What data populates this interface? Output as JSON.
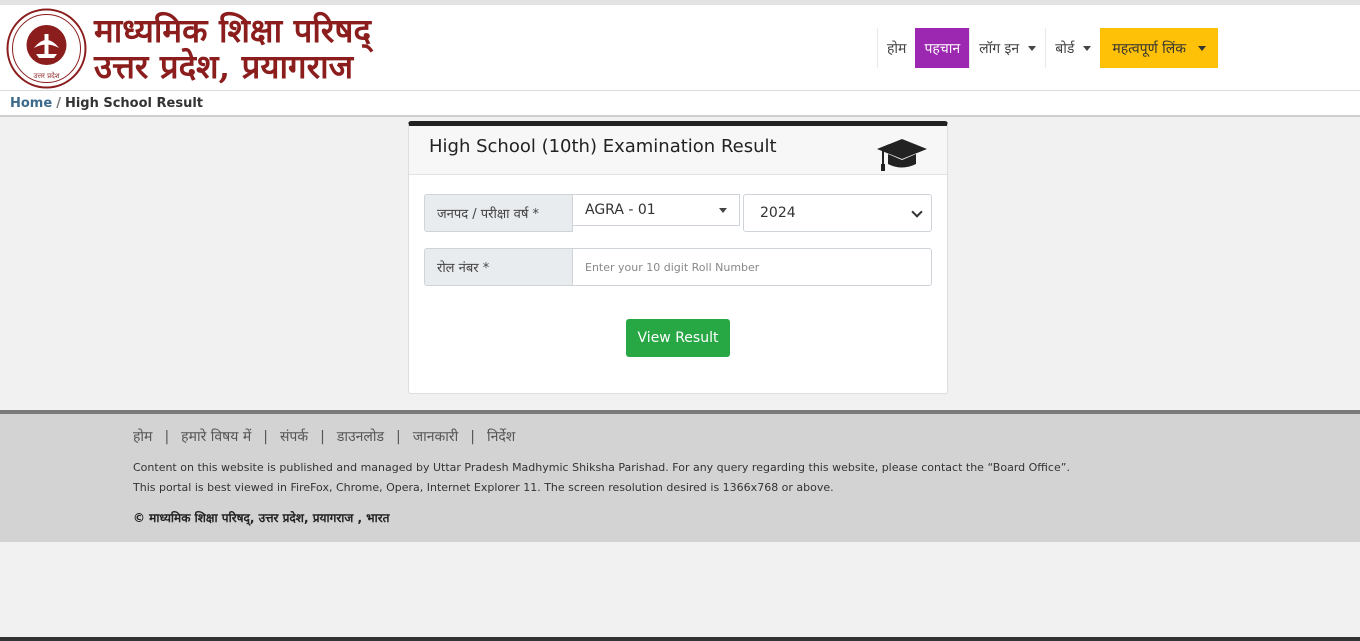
{
  "header": {
    "title_line1": "माध्यमिक शिक्षा परिषद्",
    "title_line2": "उत्तर प्रदेश, प्रयागराज",
    "logo_text": "उत्तर प्रदेश"
  },
  "nav": {
    "items": [
      {
        "label": "होम"
      },
      {
        "label": "पहचान"
      },
      {
        "label": "लॉग इन"
      },
      {
        "label": "बोर्ड"
      },
      {
        "label": "महत्वपूर्ण लिंक"
      }
    ]
  },
  "breadcrumb": {
    "home": "Home",
    "separator": "/",
    "current": "High School Result"
  },
  "card": {
    "title": "High School (10th) Examination Result",
    "icon": "graduation-cap-icon",
    "district_label": "जनपद / परीक्षा वर्ष *",
    "district_value": "AGRA - 01",
    "year_value": "2024",
    "roll_label": "रोल नंबर *",
    "roll_placeholder": "Enter your 10 digit Roll Number",
    "submit_label": "View Result"
  },
  "footer": {
    "links": [
      "होम",
      "हमारे विषय में",
      "संपर्क",
      "डाउनलोड",
      "जानकारी",
      "निर्देश"
    ],
    "separator": "|",
    "line1": "Content on this website is published and managed by Uttar Pradesh Madhymic Shiksha Parishad. For any query regarding this website, please contact the “Board Office”.",
    "line2": "This portal is best viewed in FireFox, Chrome, Opera, Internet Explorer 11. The screen resolution desired is 1366x768 or above.",
    "copyright": "© माध्यमिक शिक्षा परिषद्, उत्तर प्रदेश, प्रयागराज , भारत"
  },
  "colors": {
    "brand": "#8b1d1d",
    "nav_active": "#9c27b0",
    "nav_highlight": "#ffc107",
    "button": "#28a745"
  }
}
